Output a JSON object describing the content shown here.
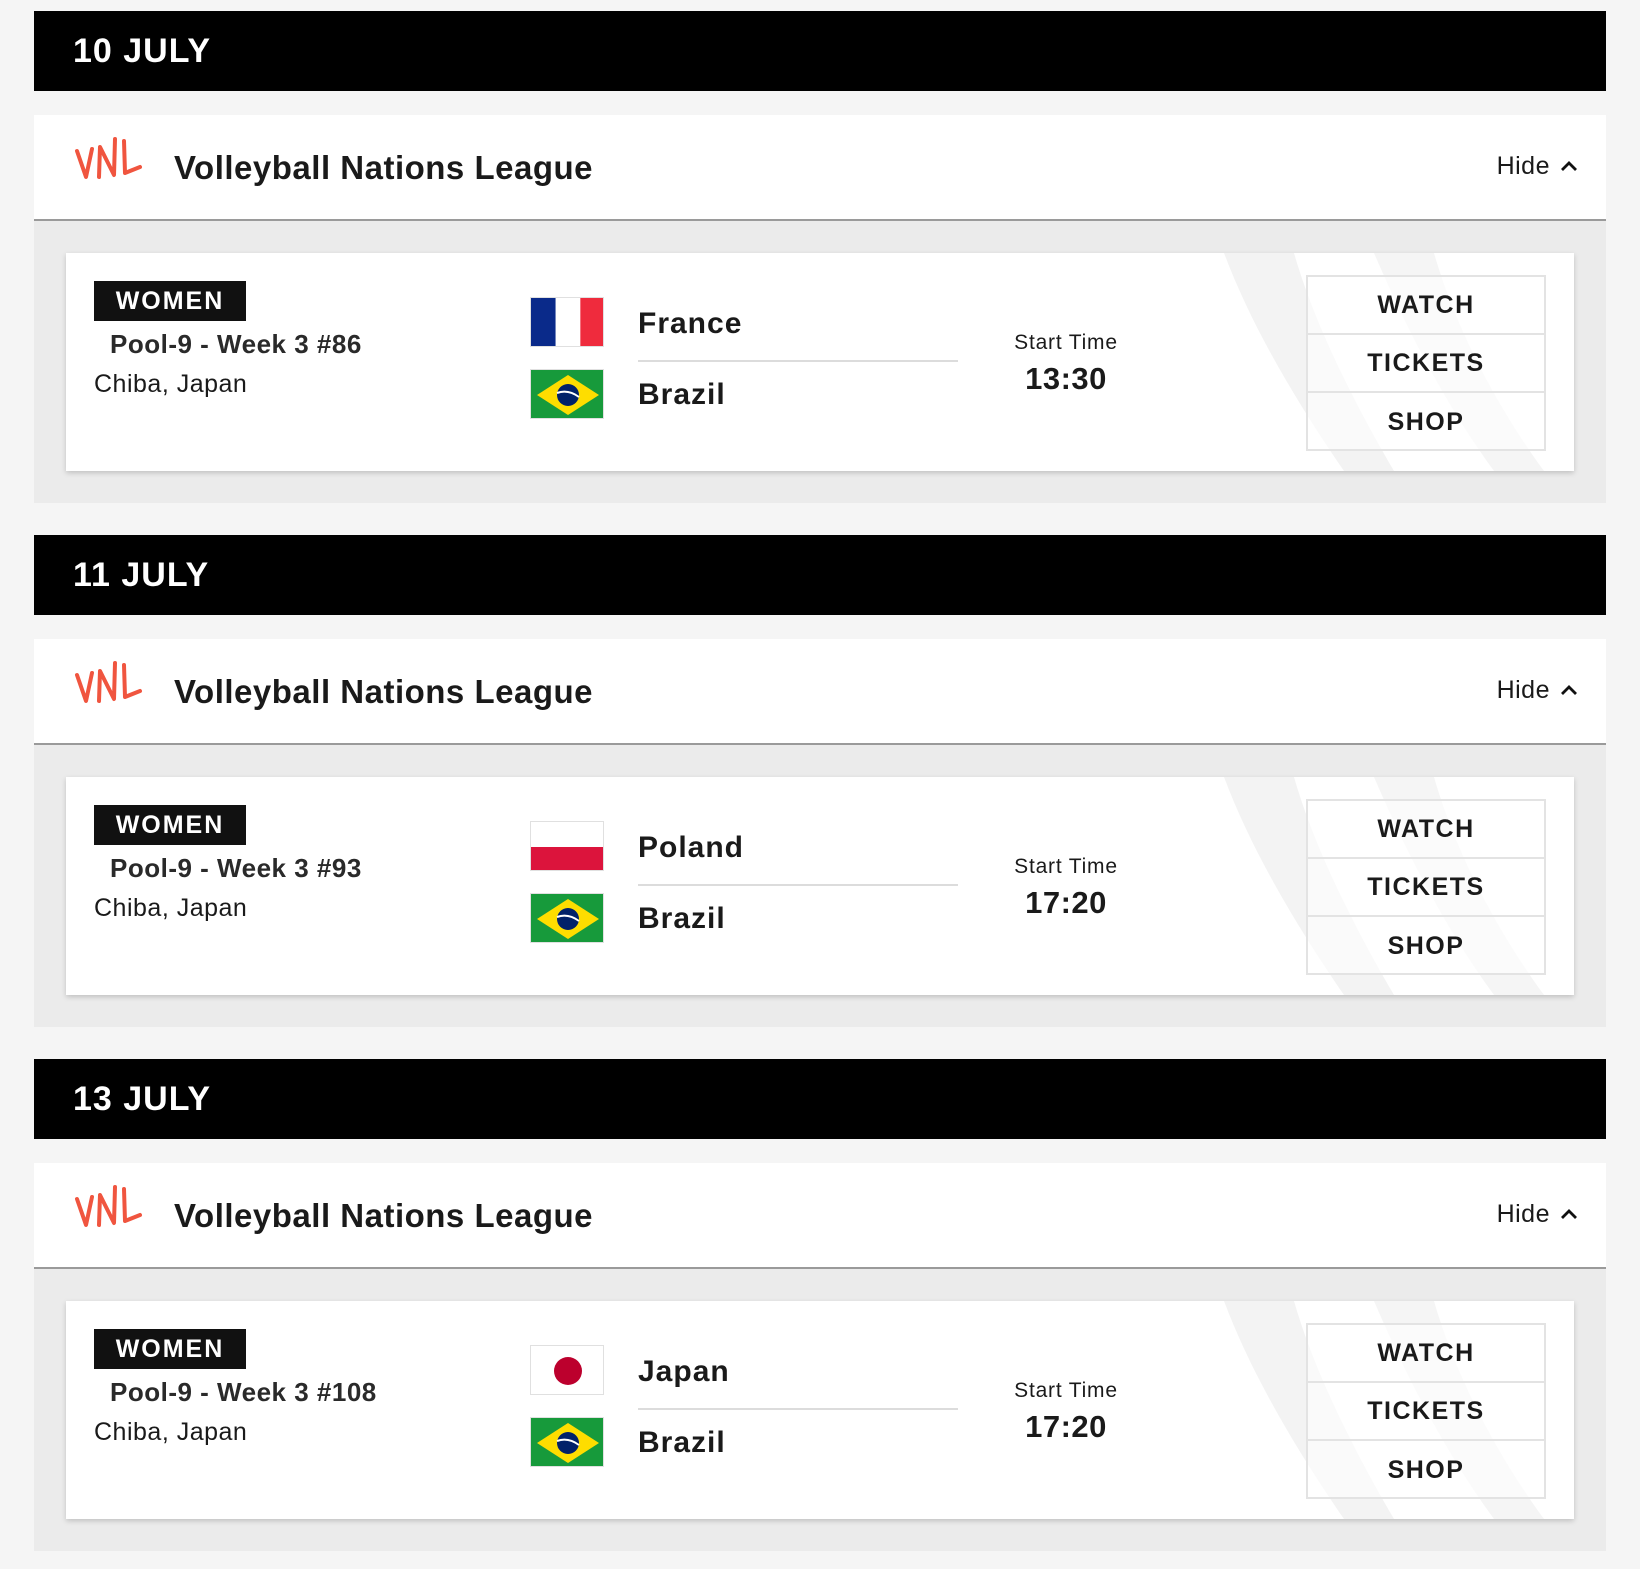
{
  "days": [
    {
      "date": "10 JULY",
      "league": {
        "name": "Volleyball Nations League",
        "toggle_label": "Hide"
      },
      "match": {
        "gender": "WOMEN",
        "pool": "Pool-9 - Week 3 #86",
        "venue": "Chiba, Japan",
        "home_team": {
          "name": "France",
          "flag": "france-flag"
        },
        "away_team": {
          "name": "Brazil",
          "flag": "brazil-flag"
        },
        "start_label": "Start Time",
        "start_time": "13:30",
        "actions": [
          "WATCH",
          "TICKETS",
          "SHOP"
        ]
      }
    },
    {
      "date": "11 JULY",
      "league": {
        "name": "Volleyball Nations League",
        "toggle_label": "Hide"
      },
      "match": {
        "gender": "WOMEN",
        "pool": "Pool-9 - Week 3 #93",
        "venue": "Chiba, Japan",
        "home_team": {
          "name": "Poland",
          "flag": "poland-flag"
        },
        "away_team": {
          "name": "Brazil",
          "flag": "brazil-flag"
        },
        "start_label": "Start Time",
        "start_time": "17:20",
        "actions": [
          "WATCH",
          "TICKETS",
          "SHOP"
        ]
      }
    },
    {
      "date": "13 JULY",
      "league": {
        "name": "Volleyball Nations League",
        "toggle_label": "Hide"
      },
      "match": {
        "gender": "WOMEN",
        "pool": "Pool-9 - Week 3 #108",
        "venue": "Chiba, Japan",
        "home_team": {
          "name": "Japan",
          "flag": "japan-flag"
        },
        "away_team": {
          "name": "Brazil",
          "flag": "brazil-flag"
        },
        "start_label": "Start Time",
        "start_time": "17:20",
        "actions": [
          "WATCH",
          "TICKETS",
          "SHOP"
        ]
      }
    }
  ],
  "colors": {
    "date_bar_bg": "#000000",
    "page_bg": "#f5f5f5",
    "logo_accent": "#f0553f",
    "badge_bg": "#111111"
  }
}
